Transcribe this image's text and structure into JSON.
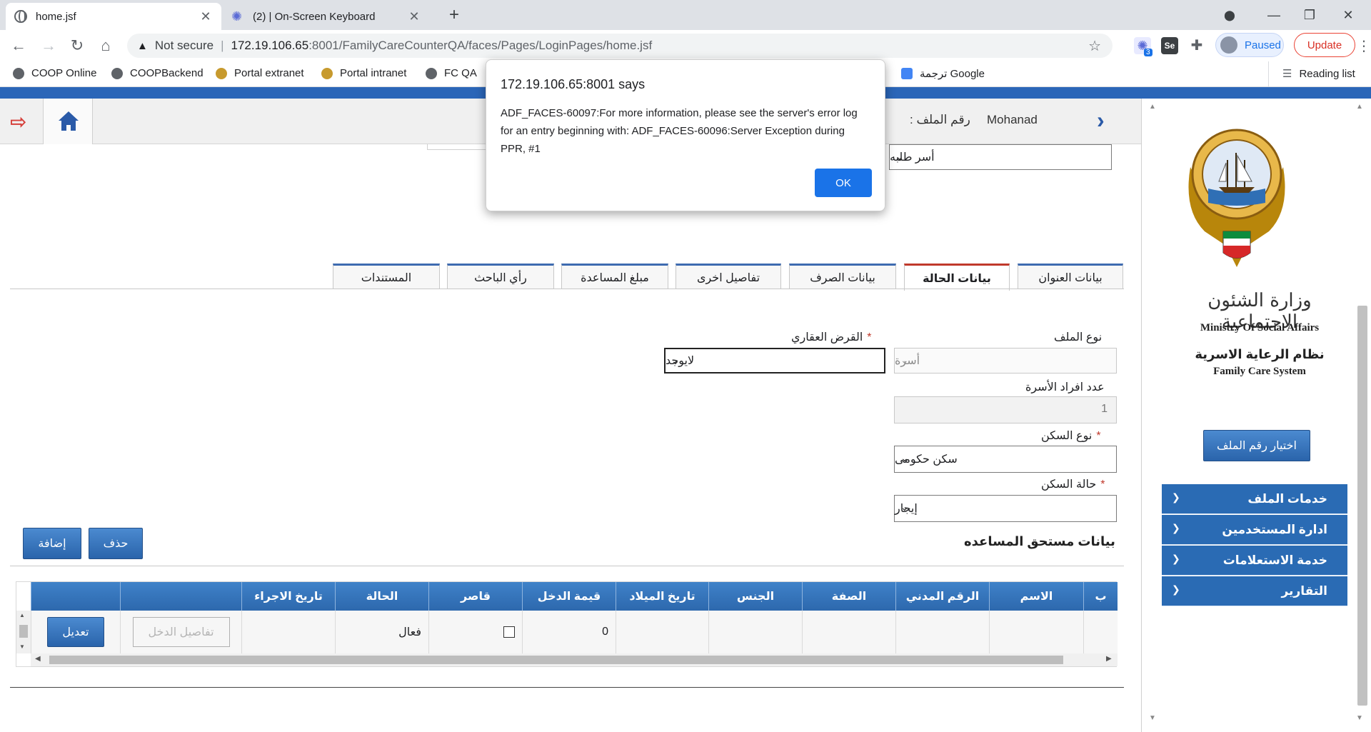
{
  "browser": {
    "tabs": [
      {
        "title": "home.jsf",
        "active": true
      },
      {
        "title": "(2) | On-Screen Keyboard",
        "active": false
      }
    ],
    "new_tab": "+",
    "omnibox": {
      "security": "Not secure",
      "host": "172.19.106.65",
      "path": ":8001/FamilyCareCounterQA/faces/Pages/LoginPages/home.jsf"
    },
    "profile_label": "Paused",
    "update_label": "Update",
    "ext_badge": "3",
    "bookmarks": [
      "COOP Online",
      "COOPBackend",
      "Portal extranet",
      "Portal intranet",
      "FC QA",
      "ترجمة Google"
    ],
    "reading_list": "Reading list"
  },
  "colors": {
    "accent": "#2a6bb4",
    "required": "#c0392b",
    "dialog_button": "#1a73e8",
    "update": "#d93025"
  },
  "dialog": {
    "title": "172.19.106.65:8001 says",
    "message": "ADF_FACES-60097:For more information, please see the server's error log for an entry beginning with: ADF_FACES-60096:Server Exception during PPR, #1",
    "ok_label": "OK"
  },
  "header": {
    "user_name": "Mohanad",
    "file_number_label": "رقم الملف :",
    "file_type_value": "أسر طلبه"
  },
  "sidebar": {
    "ministry_arabic": "وزارة الشئون الاجتماعية",
    "ministry_english": "Ministry Of Social Affairs",
    "system_arabic": "نظام الرعاية الاسرية",
    "system_english": "Family Care System",
    "choose_file_button": "اختيار رقم الملف",
    "menu": [
      "خدمات الملف",
      "ادارة المستخدمين",
      "خدمة الاستعلامات",
      "التقارير"
    ]
  },
  "tabs": [
    "بيانات العنوان",
    "بيانات الحالة",
    "بيانات الصرف",
    "تفاصيل اخرى",
    "مبلغ المساعدة",
    "رأي الباحث",
    "المستندات"
  ],
  "selected_tab": "بيانات الحالة",
  "form": {
    "file_type": {
      "label": "نوع الملف",
      "value": "أسرة"
    },
    "members_count": {
      "label": "عدد افراد الأسرة",
      "value": "1"
    },
    "housing_type": {
      "label": "نوع السكن",
      "value": "سكن حكومى"
    },
    "housing_status": {
      "label": "حالة السكن",
      "value": "إيجار"
    },
    "real_estate_loan": {
      "label": "القرض العقاري",
      "value": "لايوجد"
    },
    "required_mark": "*"
  },
  "beneficiaries": {
    "section_title": "بيانات مستحق المساعده",
    "delete_button": "حذف",
    "add_button": "إضافة",
    "columns": [
      "الاسم",
      "الرقم المدني",
      "الصفة",
      "الجنس",
      "تاريخ الميلاد",
      "قيمة الدخل",
      "قاصر",
      "الحالة",
      "تاريخ الاجراء"
    ],
    "rows": [
      {
        "name": "",
        "civil_id": "",
        "relation": "",
        "gender": "",
        "birth_date": "",
        "income": "0",
        "minor": false,
        "status": "فعال",
        "action_date": "",
        "details_button": "تفاصيل الدخل",
        "edit_button": "تعديل"
      }
    ]
  }
}
